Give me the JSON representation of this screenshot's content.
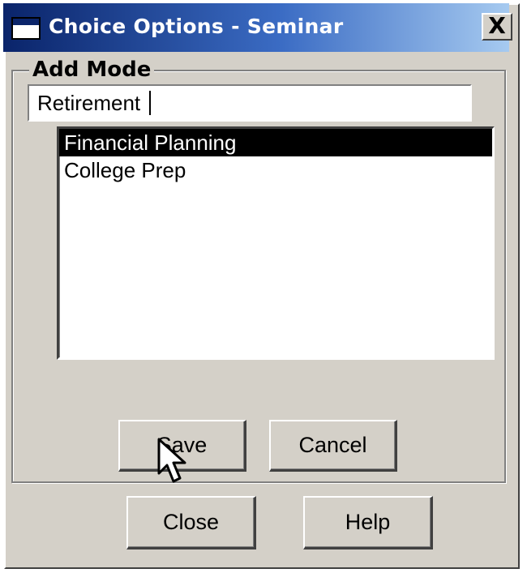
{
  "window": {
    "title": "Choice Options - Seminar",
    "close_glyph": "X"
  },
  "group": {
    "label": "Add Mode"
  },
  "input": {
    "value": "Retirement"
  },
  "list": {
    "items": [
      {
        "label": "Financial Planning",
        "selected": true
      },
      {
        "label": "College Prep",
        "selected": false
      }
    ]
  },
  "buttons": {
    "save": "Save",
    "cancel": "Cancel",
    "close": "Close",
    "help": "Help"
  },
  "colors": {
    "dialog_face": "#d4d0c8",
    "titlebar_start": "#0a246a",
    "titlebar_end": "#a6caf0",
    "selection": "#000000"
  },
  "icons": {
    "system": "window-icon",
    "close": "close-icon",
    "pointer": "mouse-pointer-icon"
  }
}
